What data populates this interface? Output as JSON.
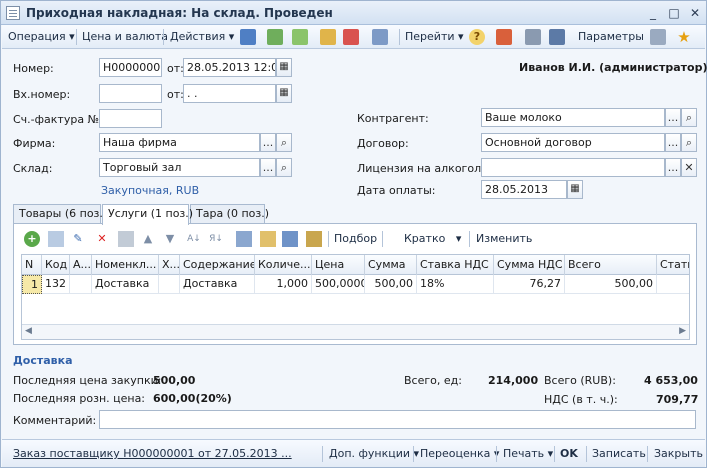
{
  "window": {
    "title": "Приходная накладная: На склад. Проведен",
    "minimize": "_",
    "maximize": "□",
    "close": "✕"
  },
  "toolbar": {
    "operation": "Операция",
    "price_currency": "Цена и валюта",
    "actions": "Действия",
    "goto": "Перейти",
    "params": "Параметры",
    "help": "?"
  },
  "form": {
    "number_label": "Номер:",
    "number_value": "Н000000000",
    "from_label": "от:",
    "date_value": "28.05.2013 12:00:",
    "user": "Иванов И.И. (администратор)",
    "in_number_label": "Вх.номер:",
    "in_number_value": "",
    "in_from_label": "от:",
    "in_date_value": " .  .",
    "invoice_label": "Сч.-фактура №",
    "invoice_value": "",
    "firm_label": "Фирма:",
    "firm_value": "Наша фирма",
    "warehouse_label": "Склад:",
    "warehouse_value": "Торговый зал",
    "price_type_link": "Закупочная, RUB",
    "counterparty_label": "Контрагент:",
    "counterparty_value": "Ваше молоко",
    "contract_label": "Договор:",
    "contract_value": "Основной договор",
    "license_label": "Лицензия на алкоголь:",
    "license_value": "",
    "pay_date_label": "Дата оплаты:",
    "pay_date_value": "28.05.2013"
  },
  "tabs": [
    {
      "label": "Товары (6 поз.)"
    },
    {
      "label": "Услуги (1 поз.)"
    },
    {
      "label": "Тара (0 поз.)"
    }
  ],
  "grid_toolbar": {
    "pick": "Подбор",
    "brief": "Кратко",
    "change": "Изменить"
  },
  "grid": {
    "columns": [
      "N",
      "Код",
      "А...",
      "Номенкл...",
      "Х...",
      "Содержание",
      "Количе...",
      "Цена",
      "Сумма",
      "Ставка НДС",
      "Сумма НДС",
      "Всего",
      "Стать"
    ],
    "rows": [
      {
        "n": "1",
        "code": "132",
        "a": "",
        "nomen": "Доставка",
        "x": "",
        "content": "Доставка",
        "qty": "1,000",
        "price": "500,0000",
        "sum": "500,00",
        "vat_rate": "18%",
        "vat_sum": "76,27",
        "total": "500,00",
        "article": ""
      }
    ]
  },
  "summary": {
    "item_title": "Доставка",
    "last_purchase_label": "Последняя цена закупки:",
    "last_purchase_value": "500,00",
    "last_retail_label": "Последняя розн. цена:",
    "last_retail_value": "600,00(20%)",
    "total_units_label": "Всего, ед:",
    "total_units_value": "214,000",
    "total_rub_label": "Всего (RUB):",
    "total_rub_value": "4 653,00",
    "vat_label": "НДС (в т. ч.):",
    "vat_value": "709,77",
    "comment_label": "Комментарий:",
    "comment_value": ""
  },
  "statusbar": {
    "order_link": "Заказ поставщику Н000000001 от 27.05.2013 ...",
    "extra_functions": "Доп. функции",
    "revaluation": "Переоценка",
    "print": "Печать",
    "ok": "OK",
    "save": "Записать",
    "close": "Закрыть"
  },
  "colors": {
    "accent": "#2f5fa8",
    "link": "#2f5fa8",
    "window_bg": "#f2f6fb"
  }
}
